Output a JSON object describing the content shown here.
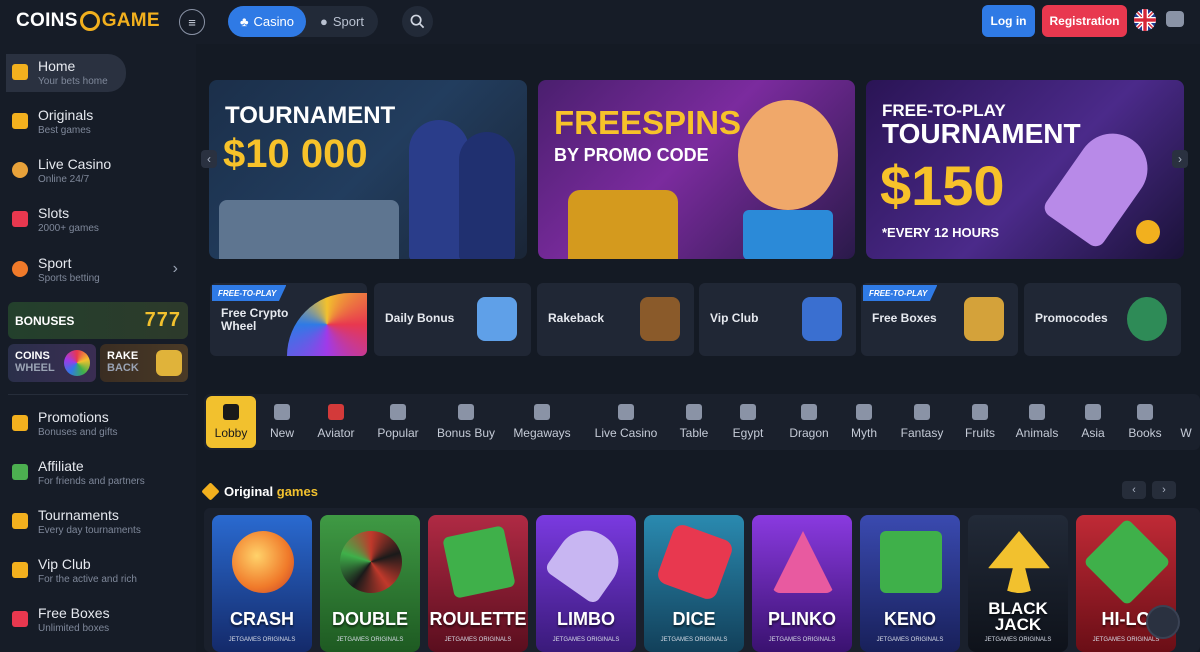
{
  "header": {
    "logo_left": "COINS",
    "logo_right": "GAME",
    "menu_icon": "≡",
    "tabs": [
      {
        "label": "Casino",
        "icon": "♣"
      },
      {
        "label": "Sport",
        "icon": "●"
      }
    ],
    "login_label": "Log in",
    "register_label": "Registration"
  },
  "sidebar": {
    "items": [
      {
        "label": "Home",
        "sub": "Your bets home",
        "color": "#f2b01e"
      },
      {
        "label": "Originals",
        "sub": "Best games",
        "color": "#f2b01e"
      },
      {
        "label": "Live Casino",
        "sub": "Online 24/7",
        "color": "#e8a23a"
      },
      {
        "label": "Slots",
        "sub": "2000+ games",
        "color": "#e8384f"
      },
      {
        "label": "Sport",
        "sub": "Sports betting",
        "color": "#f07a2a"
      },
      {
        "label": "Promotions",
        "sub": "Bonuses and gifts",
        "color": "#f2b01e"
      },
      {
        "label": "Affiliate",
        "sub": "For friends and partners",
        "color": "#4caf50"
      },
      {
        "label": "Tournaments",
        "sub": "Every day tournaments",
        "color": "#f2b01e"
      },
      {
        "label": "Vip Club",
        "sub": "For the active and rich",
        "color": "#f2b01e"
      },
      {
        "label": "Free Boxes",
        "sub": "Unlimited boxes",
        "color": "#e8384f"
      }
    ],
    "bonuses_label": "BONUSES",
    "bonuses_sevens": "777",
    "coins_wheel": {
      "l1": "COINS",
      "l2": "WHEEL"
    },
    "rake_back": {
      "l1": "RAKE",
      "l2": "BACK"
    }
  },
  "banners": [
    {
      "line1": "TOURNAMENT",
      "line2": "$10 000"
    },
    {
      "line1": "FREESPINS",
      "line2": "BY PROMO CODE"
    },
    {
      "line1": "FREE-TO-PLAY",
      "line2": "TOURNAMENT",
      "line3": "$150",
      "line4": "*EVERY 12 HOURS"
    }
  ],
  "promos": [
    {
      "label": "Free Crypto Wheel",
      "tag": "FREE-TO-PLAY",
      "color": "#c03aa0"
    },
    {
      "label": "Daily Bonus",
      "tag": "",
      "color": "#5fa0e8"
    },
    {
      "label": "Rakeback",
      "tag": "",
      "color": "#4caf50"
    },
    {
      "label": "Vip Club",
      "tag": "",
      "color": "#3a6fd0"
    },
    {
      "label": "Free Boxes",
      "tag": "FREE-TO-PLAY",
      "color": "#d4a23a"
    },
    {
      "label": "Promocodes",
      "tag": "",
      "color": "#2e8b57"
    }
  ],
  "categories": [
    "Lobby",
    "New",
    "Aviator",
    "Popular",
    "Bonus Buy",
    "Megaways",
    "Live Casino",
    "Table",
    "Egypt",
    "Dragon",
    "Myth",
    "Fantasy",
    "Fruits",
    "Animals",
    "Asia",
    "Books",
    "W"
  ],
  "section": {
    "title_a": "Original",
    "title_b": "games"
  },
  "games": [
    {
      "name": "CRASH",
      "sub": "JETGAMES ORIGINALS",
      "bg": "#1e4a9e",
      "blob": "#f07a2a"
    },
    {
      "name": "DOUBLE",
      "sub": "JETGAMES ORIGINALS",
      "bg": "#2f7a34",
      "blob": "#c0392b"
    },
    {
      "name": "ROULETTE",
      "sub": "JETGAMES ORIGINALS",
      "bg": "#8a1e34",
      "blob": "#3fb04a"
    },
    {
      "name": "LIMBO",
      "sub": "JETGAMES ORIGINALS",
      "bg": "#5a2a9e",
      "blob": "#8e7ae8"
    },
    {
      "name": "DICE",
      "sub": "JETGAMES ORIGINALS",
      "bg": "#1e6a8a",
      "blob": "#e8384f"
    },
    {
      "name": "PLINKO",
      "sub": "JETGAMES ORIGINALS",
      "bg": "#6a2a9e",
      "blob": "#e85aa0"
    },
    {
      "name": "KENO",
      "sub": "JETGAMES ORIGINALS",
      "bg": "#2a3a8a",
      "blob": "#3fb04a"
    },
    {
      "name": "BLACK JACK",
      "sub": "JETGAMES ORIGINALS",
      "bg": "#141a24",
      "blob": "#f2c12e"
    },
    {
      "name": "HI-LO",
      "sub": "JETGAMES ORIGINALS",
      "bg": "#9e1e2a",
      "blob": "#3fb04a"
    }
  ]
}
